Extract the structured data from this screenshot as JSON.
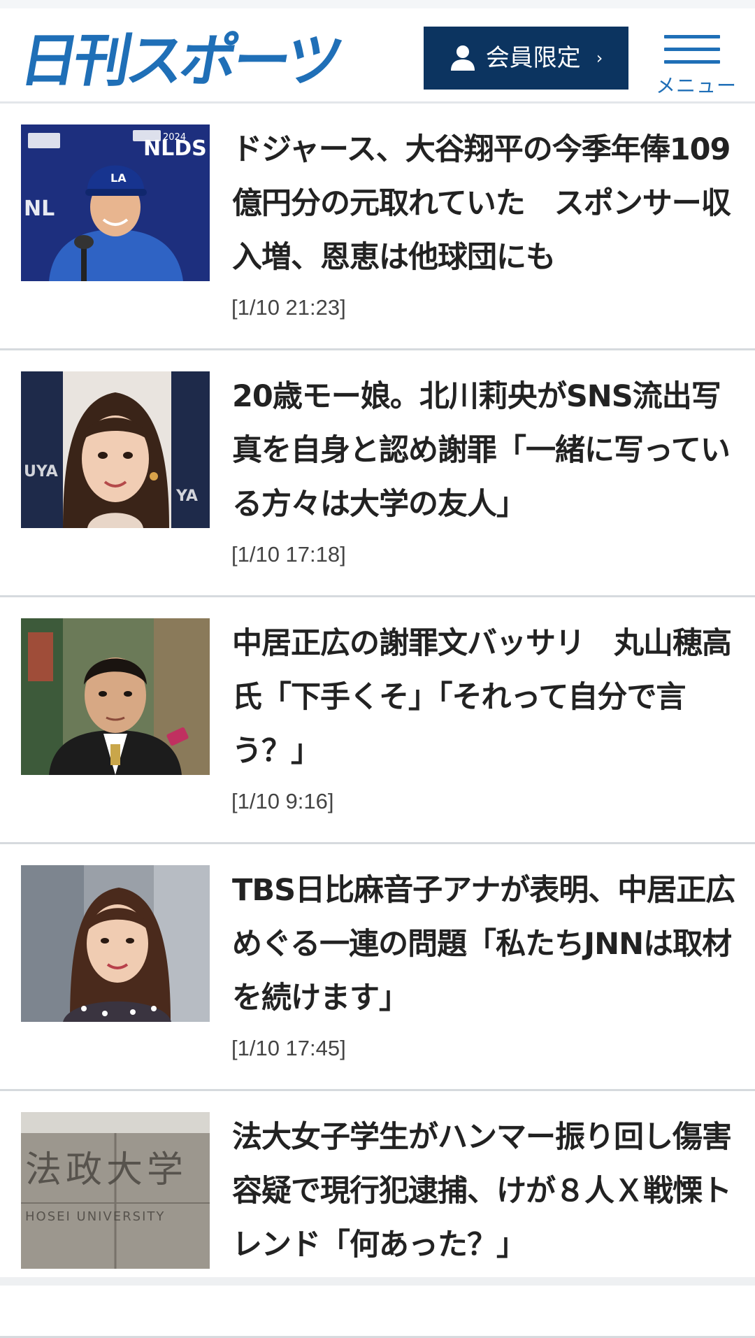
{
  "header": {
    "logo_text": "日刊スポーツ",
    "member_button_label": "会員限定",
    "member_button_chevron": "›",
    "menu_label": "メニュー",
    "brand_color": "#1f6fb7",
    "member_button_color": "#0c3460",
    "member_icon": "user-icon",
    "menu_icon": "hamburger-icon"
  },
  "articles": [
    {
      "title": "ドジャース、大谷翔平の今季年俸109億円分の元取れていた　スポンサー収入増、恩恵は他球団にも",
      "time": "[1/10 21:23]",
      "thumb": "baseball-player-press-conference-photo"
    },
    {
      "title": "20歳モー娘。北川莉央がSNS流出写真を自身と認め謝罪「一緒に写っている方々は大学の友人」",
      "time": "[1/10 17:18]",
      "thumb": "idol-portrait-photo"
    },
    {
      "title": "中居正広の謝罪文バッサリ　丸山穂高氏「下手くそ」「それって自分で言う？」",
      "time": "[1/10 9:16]",
      "thumb": "politician-portrait-photo"
    },
    {
      "title": "TBS日比麻音子アナが表明、中居正広めぐる一連の問題「私たちJNNは取材を続けます」",
      "time": "[1/10 17:45]",
      "thumb": "announcer-portrait-photo"
    },
    {
      "title": "法大女子学生がハンマー振り回し傷害容疑で現行犯逮捕、けが８人Ｘ戦慄トレンド「何あった？」",
      "time": "",
      "thumb": "university-gate-sign-photo"
    }
  ],
  "thumb_texts": {
    "nlds": "NLDS",
    "nlds_year": "2024",
    "university_sign": "法政大学",
    "university_sign_en": "HOSEI UNIVERSITY"
  }
}
